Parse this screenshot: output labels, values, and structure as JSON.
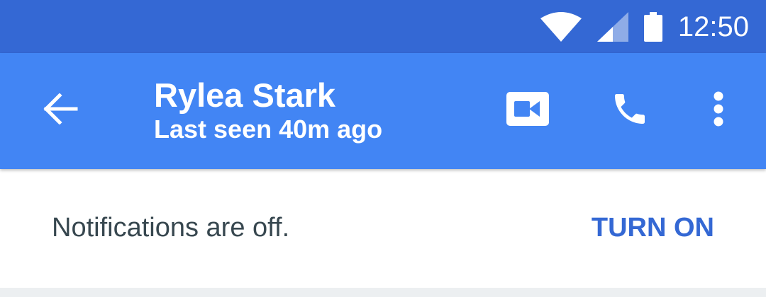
{
  "status_bar": {
    "time": "12:50",
    "icons": [
      "wifi-icon",
      "cell-signal-icon",
      "battery-icon"
    ],
    "color": "#3468D4"
  },
  "app_bar": {
    "color": "#4285F4",
    "contact_name": "Rylea Stark",
    "last_seen": "Last seen 40m ago",
    "icons": [
      "back-arrow-icon",
      "video-call-icon",
      "phone-icon",
      "more-vert-icon"
    ]
  },
  "notifications": {
    "message": "Notifications are off.",
    "action_label": "TURN ON",
    "action_color": "#3468D4"
  }
}
